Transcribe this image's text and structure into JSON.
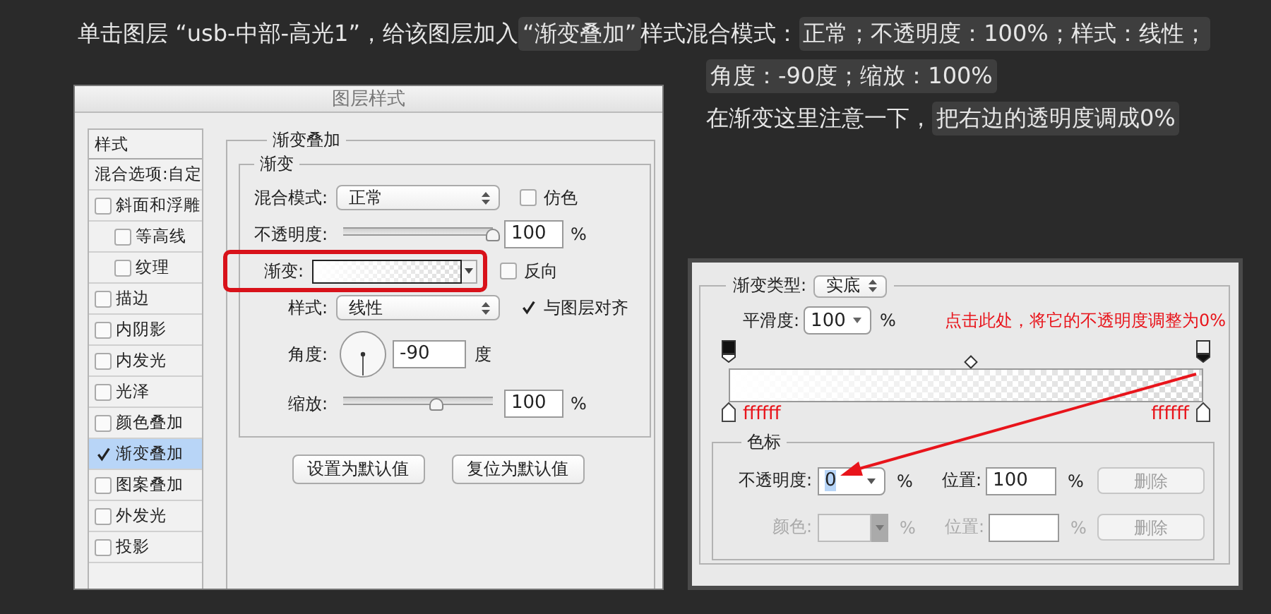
{
  "instructions": {
    "lines": [
      [
        {
          "text": "单击图层 “usb-中部-高光1”，给该图层加入",
          "highlight": false
        },
        {
          "text": "“渐变叠加”",
          "highlight": true
        },
        {
          "text": "样式混合模式：",
          "highlight": false
        },
        {
          "text": "正常；不透明度：100%；样式：线性；",
          "highlight": true
        }
      ],
      [
        {
          "text": "角度：-90度；缩放：100%",
          "highlight": true
        }
      ],
      [
        {
          "text": "在渐变这里注意一下，",
          "highlight": false
        },
        {
          "text": "把右边的透明度调成0%",
          "highlight": true
        }
      ]
    ]
  },
  "layer_style_dialog": {
    "title": "图层样式",
    "sidebar": {
      "header": "样式",
      "items": [
        {
          "label": "混合选项:自定",
          "kind": "plain",
          "selected": false
        },
        {
          "label": "斜面和浮雕",
          "kind": "checkbox",
          "checked": false,
          "selected": false,
          "children": [
            {
              "label": "等高线",
              "kind": "checkbox",
              "checked": false,
              "selected": false
            },
            {
              "label": "纹理",
              "kind": "checkbox",
              "checked": false,
              "selected": false
            }
          ]
        },
        {
          "label": "描边",
          "kind": "checkbox",
          "checked": false,
          "selected": false
        },
        {
          "label": "内阴影",
          "kind": "checkbox",
          "checked": false,
          "selected": false
        },
        {
          "label": "内发光",
          "kind": "checkbox",
          "checked": false,
          "selected": false
        },
        {
          "label": "光泽",
          "kind": "checkbox",
          "checked": false,
          "selected": false
        },
        {
          "label": "颜色叠加",
          "kind": "checkbox",
          "checked": false,
          "selected": false
        },
        {
          "label": "渐变叠加",
          "kind": "checkbox",
          "checked": true,
          "selected": true
        },
        {
          "label": "图案叠加",
          "kind": "checkbox",
          "checked": false,
          "selected": false
        },
        {
          "label": "外发光",
          "kind": "checkbox",
          "checked": false,
          "selected": false
        },
        {
          "label": "投影",
          "kind": "checkbox",
          "checked": false,
          "selected": false
        }
      ]
    },
    "group_title": "渐变叠加",
    "subgroup_title": "渐变",
    "blend_mode": {
      "label": "混合模式:",
      "value": "正常"
    },
    "dither": {
      "label": "仿色",
      "checked": false
    },
    "opacity": {
      "label": "不透明度:",
      "level": 1,
      "value": "100",
      "unit": "%"
    },
    "gradient": {
      "label": "渐变:",
      "highlighted": true
    },
    "reverse": {
      "label": "反向",
      "checked": false
    },
    "style": {
      "label": "样式:",
      "value": "线性"
    },
    "align_with_layer": {
      "label": "与图层对齐",
      "checked": true
    },
    "angle": {
      "label": "角度:",
      "value": "-90",
      "unit": "度"
    },
    "scale": {
      "label": "缩放:",
      "level": 0.62,
      "value": "100",
      "unit": "%"
    },
    "buttons": [
      "设置为默认值",
      "复位为默认值"
    ]
  },
  "gradient_editor": {
    "gradient_type": {
      "label": "渐变类型:",
      "value": "实底"
    },
    "smoothness": {
      "label": "平滑度:",
      "value": "100",
      "unit": "%"
    },
    "annotation": "点击此处，将它的不透明度调整为0%",
    "opacity_stops": [
      {
        "selected": false
      },
      {
        "selected": true
      }
    ],
    "color_stops": [
      {
        "label": "ffffff"
      },
      {
        "label": "ffffff"
      }
    ],
    "stops_group_title": "色标",
    "opacity_row": {
      "label": "不透明度:",
      "value": "0",
      "unit": "%",
      "location_label": "位置:",
      "location_value": "100",
      "location_unit": "%",
      "delete": "删除",
      "disabled": false,
      "delete_disabled": true
    },
    "color_row": {
      "label": "颜色:",
      "unit": "%",
      "location_label": "位置:",
      "delete": "删除",
      "disabled": true,
      "delete_disabled": true
    }
  }
}
